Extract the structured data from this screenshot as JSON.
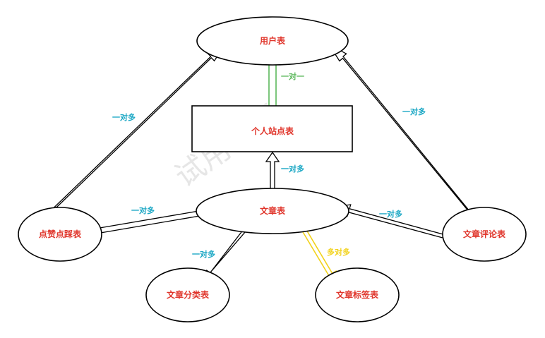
{
  "watermark": "试用水印",
  "nodes": {
    "user": "用户表",
    "site": "个人站点表",
    "article": "文章表",
    "updown": "点赞点踩表",
    "comment": "文章评论表",
    "category": "文章分类表",
    "tag": "文章标签表"
  },
  "edges": {
    "user_site": "一对一",
    "updown_user": "一对多",
    "comment_user": "一对多",
    "article_site": "一对多",
    "updown_article": "一对多",
    "comment_article": "一对多",
    "article_category": "一对多",
    "article_tag": "多对多"
  },
  "colors": {
    "node_text": "#e0352b",
    "edge_text": "#1aa7c4",
    "one_to_one": "#5cb85c",
    "many_to_many": "#f2d21b",
    "outline": "#000000"
  }
}
